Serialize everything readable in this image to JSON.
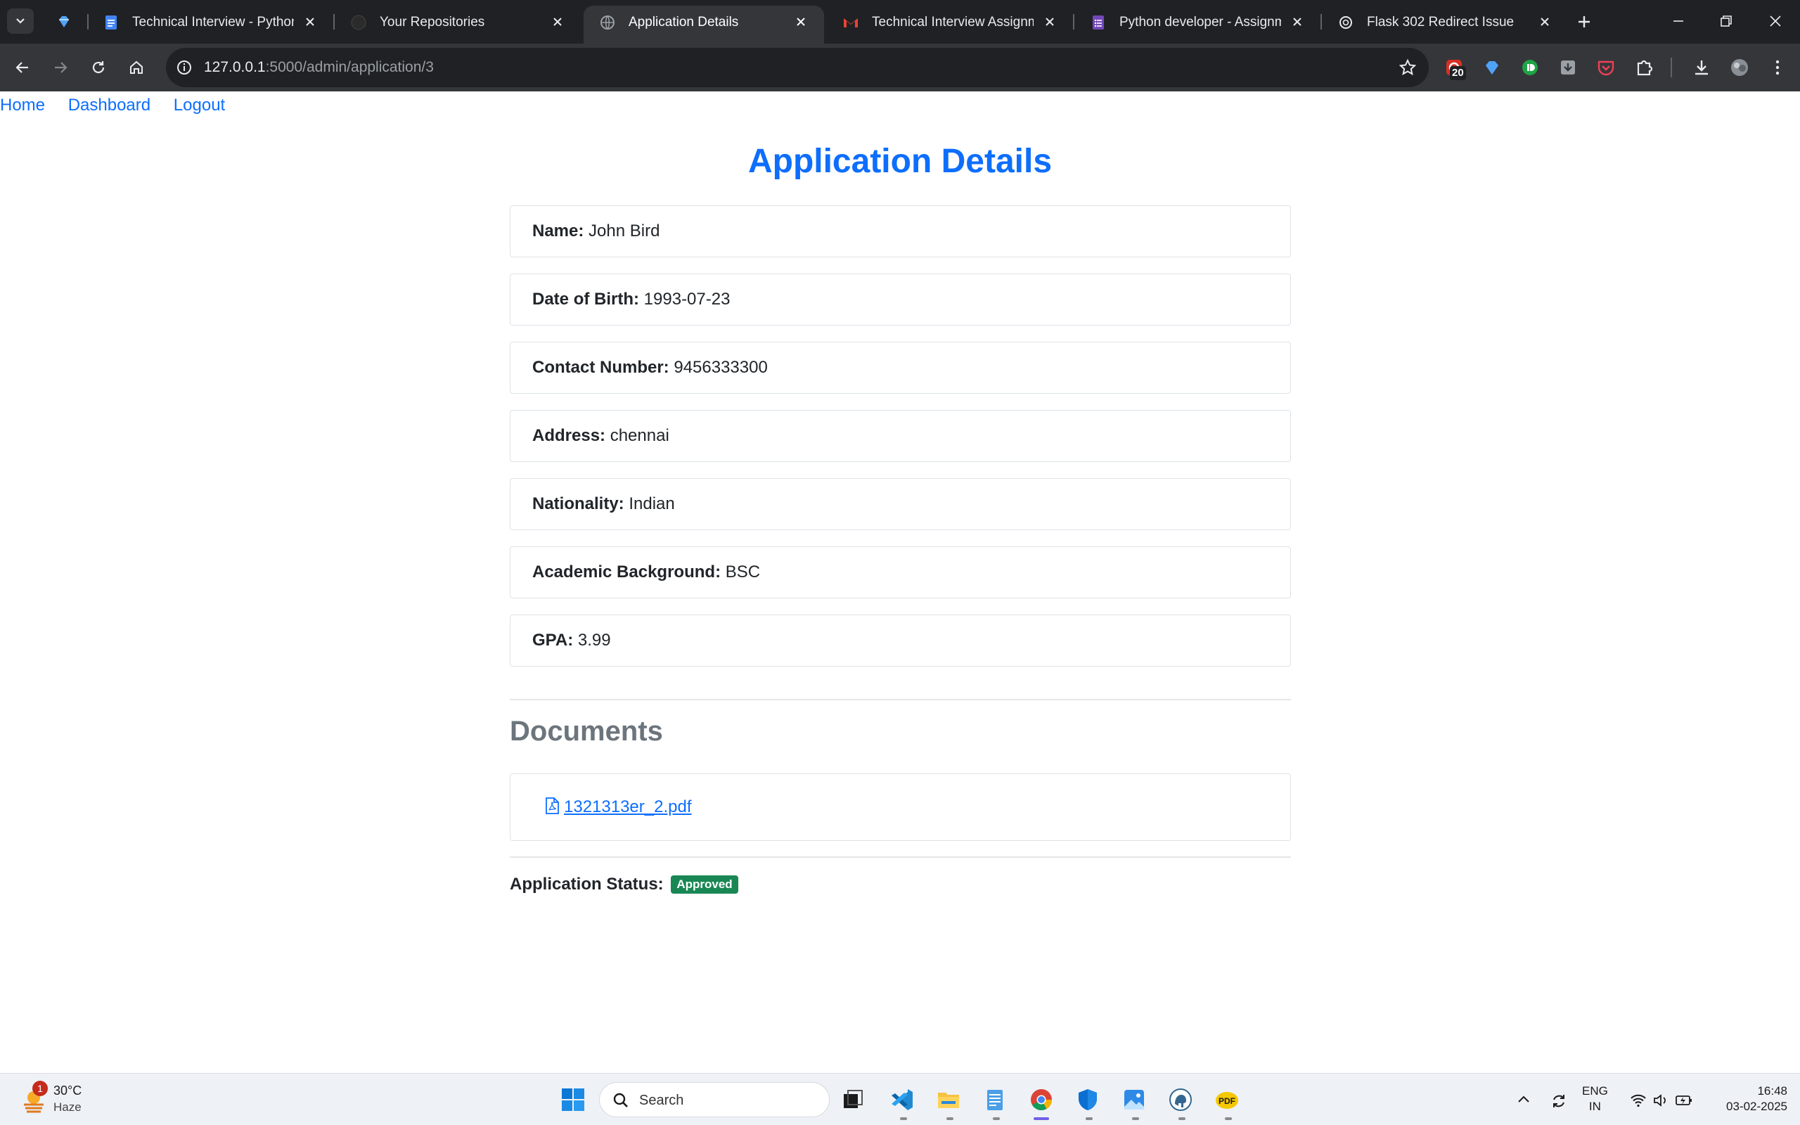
{
  "browser": {
    "tabs": [
      {
        "title": "Technical Interview - Python",
        "icon": "google-docs-icon"
      },
      {
        "title": "Your Repositories",
        "icon": "github-icon"
      },
      {
        "title": "Application Details",
        "icon": "globe-icon"
      },
      {
        "title": "Technical Interview Assignment",
        "icon": "gmail-icon"
      },
      {
        "title": "Python developer - Assignment",
        "icon": "google-forms-icon"
      },
      {
        "title": "Flask 302 Redirect Issue",
        "icon": "chatgpt-icon"
      }
    ],
    "url_host": "127.0.0.1",
    "url_rest": ":5000/admin/application/3",
    "extension_badge": "20"
  },
  "nav": {
    "links": [
      "Home",
      "Dashboard",
      "Logout"
    ]
  },
  "page": {
    "title": "Application Details",
    "fields": [
      {
        "label": "Name:",
        "value": "John Bird"
      },
      {
        "label": "Date of Birth:",
        "value": "1993-07-23"
      },
      {
        "label": "Contact Number:",
        "value": "9456333300"
      },
      {
        "label": "Address:",
        "value": "chennai"
      },
      {
        "label": "Nationality:",
        "value": "Indian"
      },
      {
        "label": "Academic Background:",
        "value": "BSC"
      },
      {
        "label": "GPA:",
        "value": "3.99"
      }
    ],
    "documents_title": "Documents",
    "documents": [
      {
        "name": "1321313er_2.pdf",
        "icon": "pdf-file-icon"
      }
    ],
    "status_label": "Application Status:",
    "status_value": "Approved"
  },
  "colors": {
    "link": "#0d6efd",
    "status_badge": "#198754",
    "muted_heading": "#6c757d"
  },
  "taskbar": {
    "weather_temp": "30°C",
    "weather_cond": "Haze",
    "weather_badge": "1",
    "search_placeholder": "Search",
    "lang_line1": "ENG",
    "lang_line2": "IN",
    "time": "16:48",
    "date": "03-02-2025"
  }
}
